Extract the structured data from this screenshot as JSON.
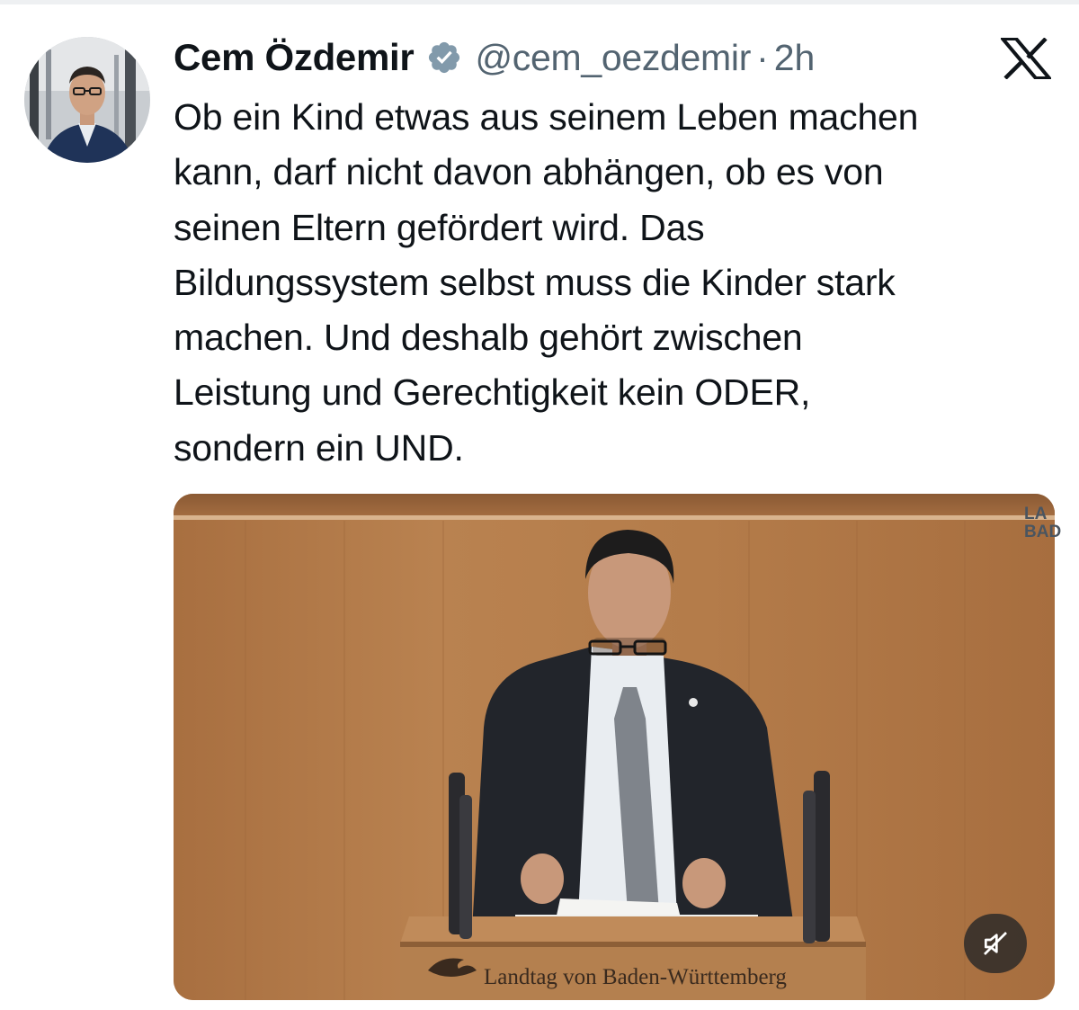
{
  "tweet": {
    "author_name": "Cem Özdemir",
    "author_handle": "@cem_oezdemir",
    "separator": "·",
    "time": "2h",
    "verified": true,
    "text": "Ob ein Kind etwas aus seinem Leben machen\nkann, darf nicht davon abhängen, ob es von\nseinen Eltern gefördert wird. Das\nBildungssystem selbst muss die Kinder stark\nmachen. Und deshalb gehört zwischen\nLeistung und Gerechtigkeit kein ODER,\nsondern ein UND."
  },
  "media": {
    "type": "video",
    "podium_label": "Landtag von Baden-Württemberg",
    "corner_watermark": "LA\nBAD",
    "muted": true
  },
  "icons": {
    "verified": "verified-badge-icon",
    "platform": "x-logo-icon",
    "mute": "speaker-muted-icon"
  },
  "colors": {
    "text_primary": "#0f1419",
    "text_secondary": "#536471",
    "verified_badge": "#829aab",
    "wood": "#b07a4a"
  }
}
